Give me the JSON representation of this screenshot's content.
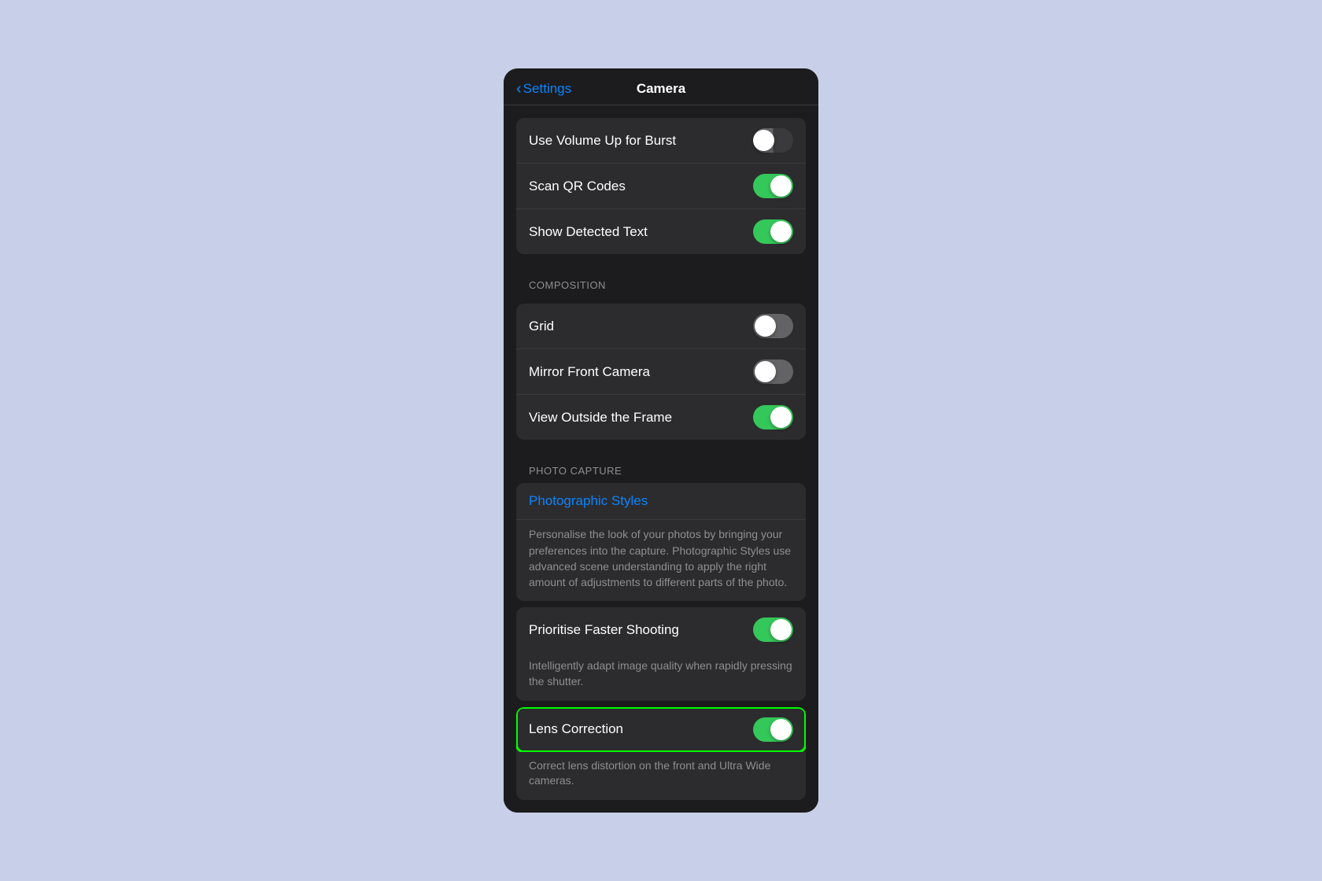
{
  "nav": {
    "back_label": "Settings",
    "title": "Camera"
  },
  "toggles": {
    "on_color": "#34c759",
    "off_color": "#636366"
  },
  "top_section": {
    "rows": [
      {
        "label": "Use Volume Up for Burst",
        "state": "half"
      },
      {
        "label": "Scan QR Codes",
        "state": "on"
      },
      {
        "label": "Show Detected Text",
        "state": "on"
      }
    ]
  },
  "composition": {
    "header": "COMPOSITION",
    "rows": [
      {
        "label": "Grid",
        "state": "off"
      },
      {
        "label": "Mirror Front Camera",
        "state": "off"
      },
      {
        "label": "View Outside the Frame",
        "state": "on"
      }
    ]
  },
  "photo_capture": {
    "header": "PHOTO CAPTURE",
    "photographic_styles": {
      "label": "Photographic Styles",
      "description": "Personalise the look of your photos by bringing your preferences into the capture. Photographic Styles use advanced scene understanding to apply the right amount of adjustments to different parts of the photo."
    },
    "prioritise_faster_shooting": {
      "label": "Prioritise Faster Shooting",
      "state": "on",
      "description": "Intelligently adapt image quality when rapidly pressing the shutter."
    },
    "lens_correction": {
      "label": "Lens Correction",
      "state": "on",
      "description": "Correct lens distortion on the front and Ultra Wide cameras."
    }
  }
}
